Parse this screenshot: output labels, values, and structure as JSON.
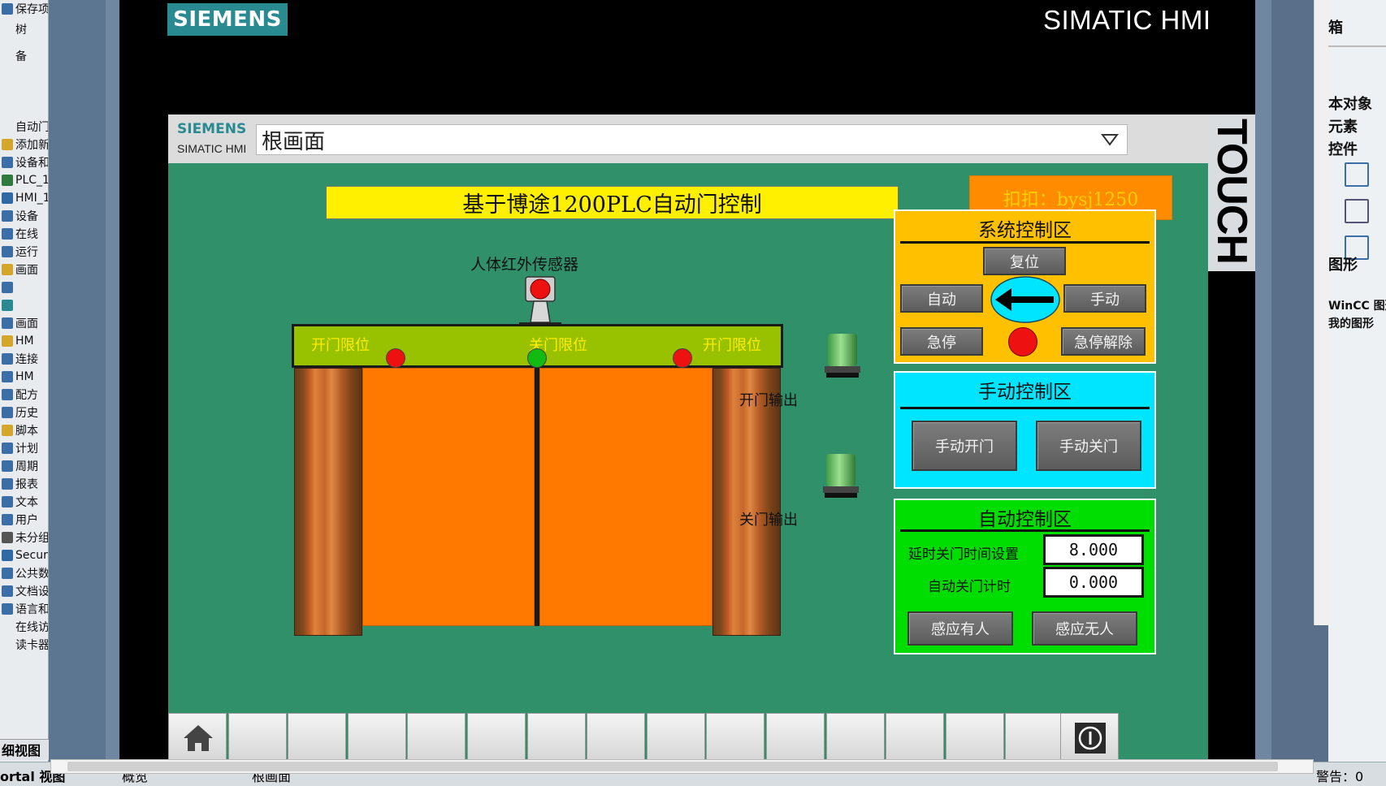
{
  "ide_left": {
    "items": [
      {
        "label": "保存项",
        "icon_color": "#3a6ea5"
      },
      {
        "label": "树",
        "icon_color": "#e9ecef"
      },
      {
        "label": "备",
        "icon_color": "#e9ecef"
      },
      {
        "label": "自动门博途",
        "icon_color": "#e9ecef"
      },
      {
        "label": "添加新",
        "icon_color": "#d4a72c"
      },
      {
        "label": "设备和",
        "icon_color": "#3a6ea5"
      },
      {
        "label": "PLC_1",
        "icon_color": "#2f7a3c"
      },
      {
        "label": "HMI_1",
        "icon_color": "#2f6aa5"
      },
      {
        "label": "设备",
        "icon_color": "#3a6ea5"
      },
      {
        "label": "在线",
        "icon_color": "#3a6ea5"
      },
      {
        "label": "运行",
        "icon_color": "#3a6ea5"
      },
      {
        "label": "画面",
        "icon_color": "#d4a72c"
      },
      {
        "label": "",
        "icon_color": "#3a6ea5"
      },
      {
        "label": "",
        "icon_color": "#2a8a91"
      },
      {
        "label": "画面",
        "icon_color": "#3a6ea5"
      },
      {
        "label": "HM",
        "icon_color": "#d4a72c"
      },
      {
        "label": "连接",
        "icon_color": "#3a6ea5"
      },
      {
        "label": "HM",
        "icon_color": "#3a6ea5"
      },
      {
        "label": "配方",
        "icon_color": "#3a6ea5"
      },
      {
        "label": "历史",
        "icon_color": "#3a6ea5"
      },
      {
        "label": "脚本",
        "icon_color": "#d4a72c"
      },
      {
        "label": "计划",
        "icon_color": "#3a6ea5"
      },
      {
        "label": "周期",
        "icon_color": "#3a6ea5"
      },
      {
        "label": "报表",
        "icon_color": "#3a6ea5"
      },
      {
        "label": "文本",
        "icon_color": "#3a6ea5"
      },
      {
        "label": "用户",
        "icon_color": "#3a6ea5"
      },
      {
        "label": "未分组",
        "icon_color": "#555555"
      },
      {
        "label": "Secur",
        "icon_color": "#2f6aa5"
      },
      {
        "label": "公共数",
        "icon_color": "#3a6ea5"
      },
      {
        "label": "文档设",
        "icon_color": "#3a6ea5"
      },
      {
        "label": "语言和",
        "icon_color": "#3a6ea5"
      },
      {
        "label": "在线访问",
        "icon_color": "#e9ecef"
      },
      {
        "label": "读卡器/US",
        "icon_color": "#e9ecef"
      }
    ],
    "detail_view": "细视图",
    "portal_view": "ortal 视图"
  },
  "ide_right": {
    "title": "箱",
    "items": [
      "本对象",
      "元素",
      "控件",
      "图形"
    ],
    "graphic_items": [
      "WinCC 图形",
      "我的图形"
    ]
  },
  "statusbar": {
    "tab_overview": "概览",
    "tab_root": "根画面",
    "status_right": "警告：0"
  },
  "device": {
    "logo": "SIEMENS",
    "brand": "SIMATIC HMI",
    "touch": "TOUCH"
  },
  "hmi": {
    "header_logo": "SIEMENS",
    "header_sub": "SIMATIC HMI",
    "screen_select": "根画面",
    "title": "基于博途1200PLC自动门控制",
    "contact": "扣扣：bysj1250",
    "sensor_label": "人体红外传感器",
    "limit_left": "开门限位",
    "limit_center": "关门限位",
    "limit_right": "开门限位",
    "lamp_open_label": "开门输出",
    "lamp_close_label": "关门输出",
    "colors": {
      "background": "#2f9069",
      "indicator_red": "#ee1111",
      "indicator_green": "#11bb11",
      "door": "#ff7800"
    },
    "system_panel": {
      "title": "系统控制区",
      "reset": "复位",
      "auto": "自动",
      "manual": "手动",
      "estop": "急停",
      "estop_release": "急停解除",
      "color": "#ffc000"
    },
    "manual_panel": {
      "title": "手动控制区",
      "open": "手动开门",
      "close": "手动关门",
      "color": "#00e5ff"
    },
    "auto_panel": {
      "title": "自动控制区",
      "delay_label": "延时关门时间设置",
      "delay_value": "8.000",
      "timer_label": "自动关门计时",
      "timer_value": "0.000",
      "sense_yes": "感应有人",
      "sense_no": "感应无人",
      "color": "#00dd00"
    },
    "softkeys": {
      "home_icon": "home-icon",
      "info_icon": "info-icon",
      "count": 16
    }
  }
}
